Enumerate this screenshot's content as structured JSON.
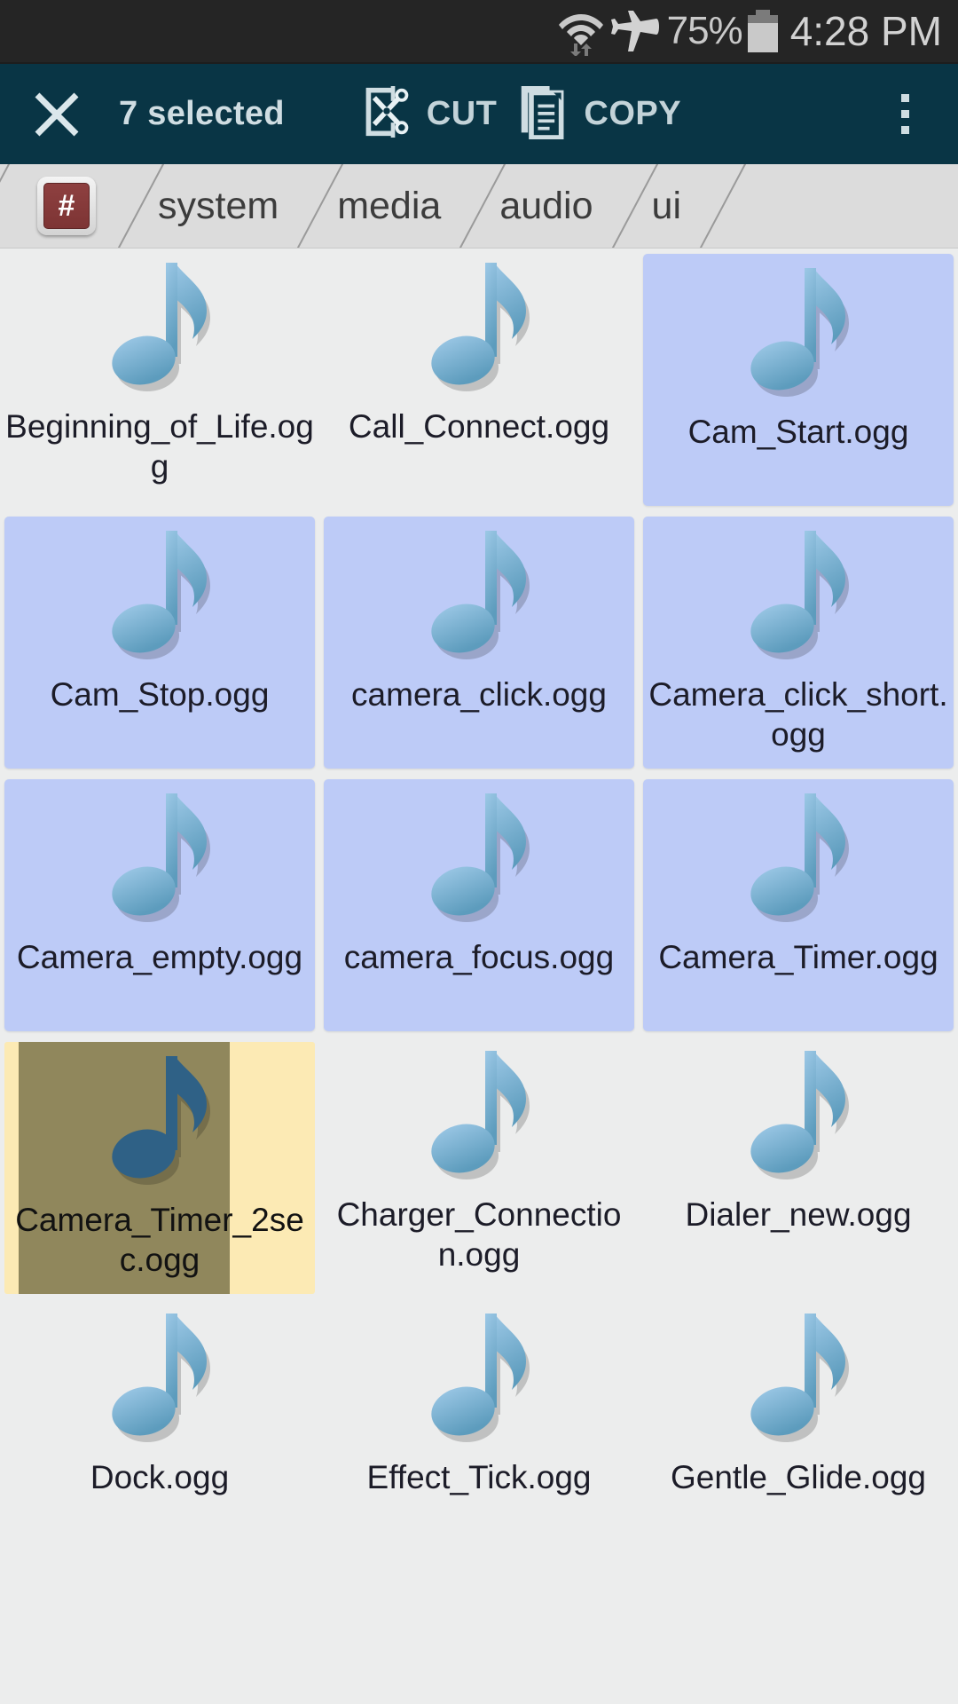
{
  "statusbar": {
    "wifi_icon": "wifi-icon",
    "airplane_icon": "airplane-mode-icon",
    "battery_percent": "75%",
    "battery_icon": "battery-icon",
    "time": "4:28 PM"
  },
  "actionbar": {
    "close_icon": "close-icon",
    "selection_title": "7 selected",
    "cut_icon": "cut-icon",
    "cut_label": "CUT",
    "copy_icon": "copy-icon",
    "copy_label": "COPY",
    "overflow_icon": "more-options-icon",
    "bg_color": "#093545",
    "text_color": "#c3d3d9"
  },
  "breadcrumb": {
    "root_icon": "root-hash-icon",
    "root_symbol": "#",
    "items": [
      {
        "label": "system"
      },
      {
        "label": "media"
      },
      {
        "label": "audio"
      },
      {
        "label": "ui"
      }
    ]
  },
  "grid": {
    "file_icon": "music-note-icon",
    "selected_color": "#bdcbf7",
    "pressed_color": "#fceab4",
    "files": [
      {
        "name": "Beginning_of_Life.ogg",
        "state": "normal"
      },
      {
        "name": "Call_Connect.ogg",
        "state": "normal"
      },
      {
        "name": "Cam_Start.ogg",
        "state": "selected"
      },
      {
        "name": "Cam_Stop.ogg",
        "state": "selected"
      },
      {
        "name": "camera_click.ogg",
        "state": "selected"
      },
      {
        "name": "Camera_click_short.ogg",
        "state": "selected"
      },
      {
        "name": "Camera_empty.ogg",
        "state": "selected"
      },
      {
        "name": "camera_focus.ogg",
        "state": "selected"
      },
      {
        "name": "Camera_Timer.ogg",
        "state": "selected"
      },
      {
        "name": "Camera_Timer_2sec.ogg",
        "state": "pressed"
      },
      {
        "name": "Charger_Connection.ogg",
        "state": "normal"
      },
      {
        "name": "Dialer_new.ogg",
        "state": "normal"
      },
      {
        "name": "Dock.ogg",
        "state": "normal"
      },
      {
        "name": "Effect_Tick.ogg",
        "state": "normal"
      },
      {
        "name": "Gentle_Glide.ogg",
        "state": "normal"
      }
    ]
  }
}
